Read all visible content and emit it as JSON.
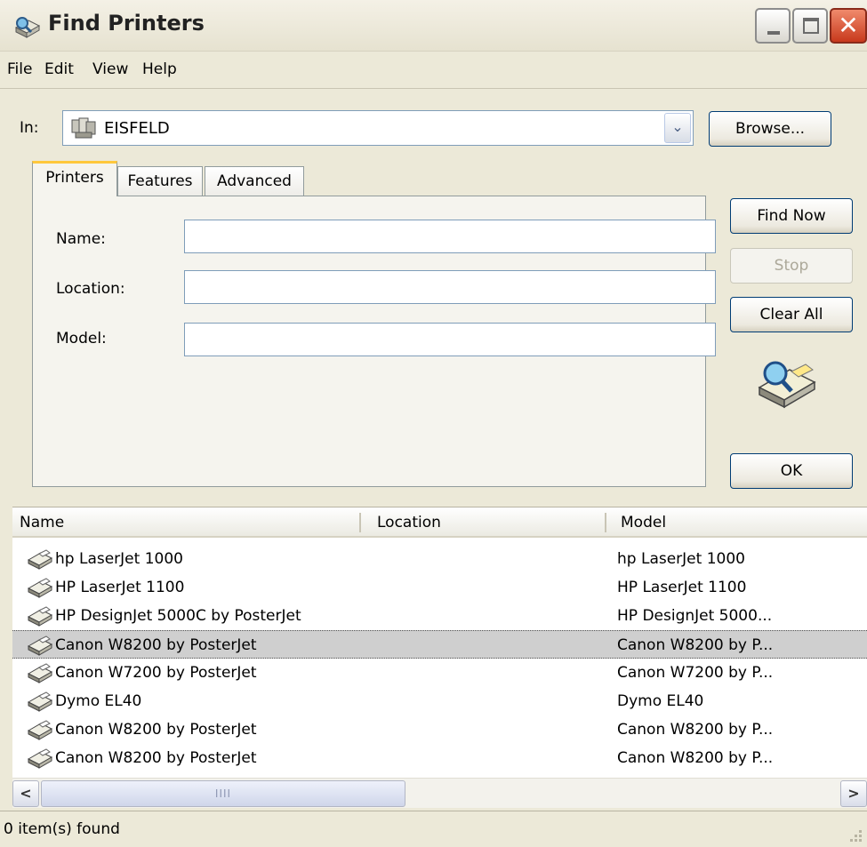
{
  "window": {
    "title": "Find Printers",
    "close_glyph": "✕"
  },
  "menu": {
    "items": [
      {
        "label": "File"
      },
      {
        "label": "Edit"
      },
      {
        "label": "View"
      },
      {
        "label": "Help"
      }
    ]
  },
  "search_scope": {
    "label": "In:",
    "value": "EISFELD",
    "icon": "directory-icon",
    "arrow_glyph": "⌄",
    "browse_label": "Browse..."
  },
  "tabs": [
    {
      "label": "Printers",
      "active": true
    },
    {
      "label": "Features",
      "active": false
    },
    {
      "label": "Advanced",
      "active": false
    }
  ],
  "form": {
    "name_label": "Name:",
    "name_value": "",
    "location_label": "Location:",
    "location_value": "",
    "model_label": "Model:",
    "model_value": ""
  },
  "actions": {
    "find_now": "Find Now",
    "stop": "Stop",
    "clear_all": "Clear All",
    "ok": "OK"
  },
  "results": {
    "columns": [
      "Name",
      "Location",
      "Model"
    ],
    "rows": [
      {
        "name": "hp LaserJet 1000",
        "location": "",
        "model": "hp LaserJet 1000",
        "selected": false
      },
      {
        "name": "HP LaserJet 1100",
        "location": "",
        "model": "HP LaserJet 1100",
        "selected": false
      },
      {
        "name": "HP DesignJet 5000C by PosterJet",
        "location": "",
        "model": "HP DesignJet 5000...",
        "selected": false
      },
      {
        "name": "Canon W8200 by PosterJet",
        "location": "",
        "model": "Canon W8200 by P...",
        "selected": true
      },
      {
        "name": "Canon W7200 by PosterJet",
        "location": "",
        "model": "Canon W7200 by P...",
        "selected": false
      },
      {
        "name": "Dymo EL40",
        "location": "",
        "model": "Dymo EL40",
        "selected": false
      },
      {
        "name": "Canon W8200 by PosterJet",
        "location": "",
        "model": "Canon W8200 by P...",
        "selected": false
      },
      {
        "name": "Canon W8200 by PosterJet",
        "location": "",
        "model": "Canon W8200 by P...",
        "selected": false
      }
    ]
  },
  "scrollbar": {
    "left_glyph": "<",
    "right_glyph": ">",
    "thumb_grip": "IIII"
  },
  "status": {
    "text": "0 item(s) found"
  },
  "colors": {
    "window_bg": "#ece9d8",
    "selection": "#cfcfcf",
    "active_tab_accent": "#ffc83c",
    "close_button": "#c8391c"
  }
}
